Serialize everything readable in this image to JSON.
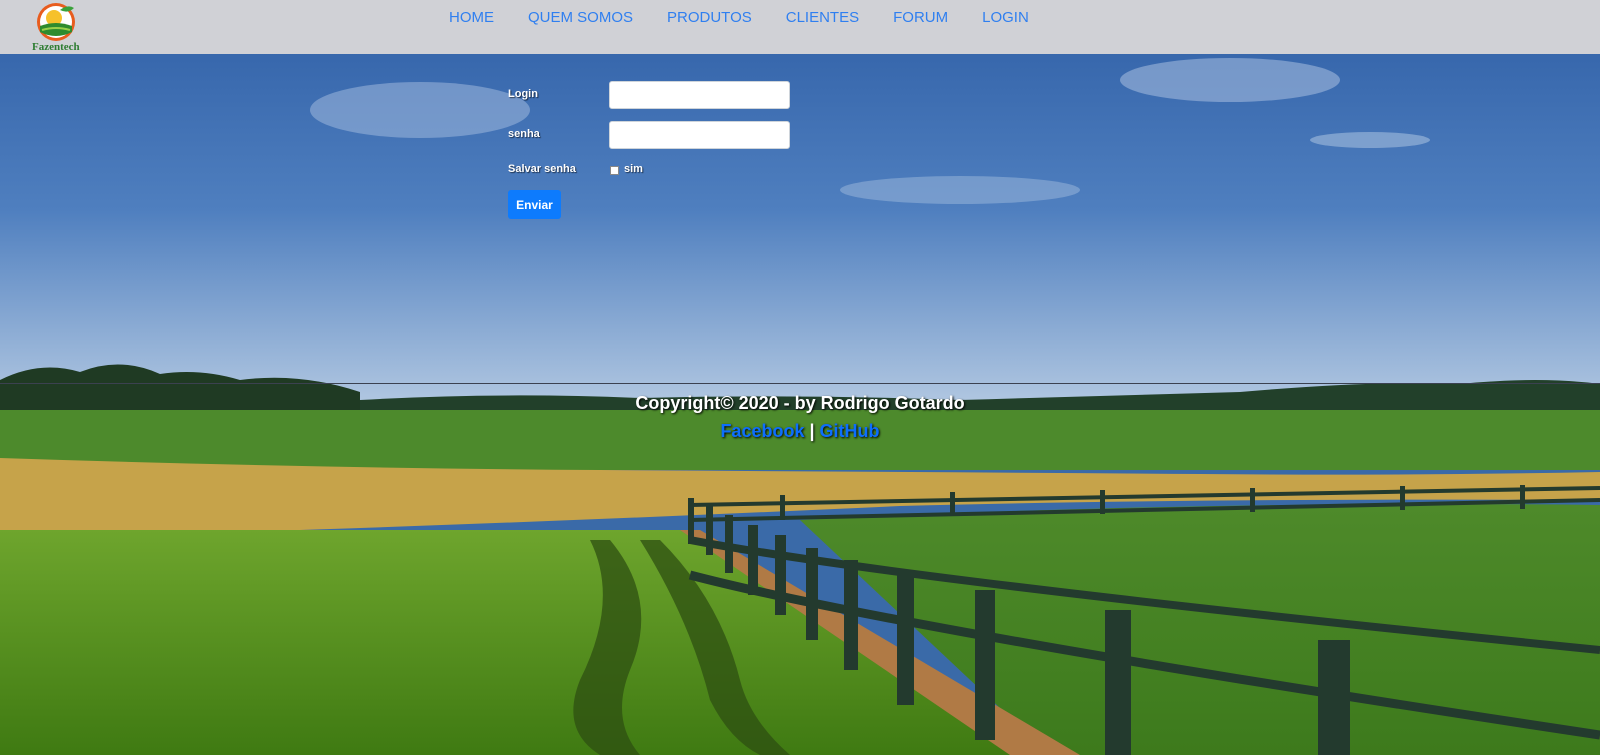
{
  "brand": {
    "name": "Fazentech"
  },
  "nav": {
    "items": [
      {
        "label": "HOME"
      },
      {
        "label": "QUEM SOMOS"
      },
      {
        "label": "PRODUTOS"
      },
      {
        "label": "CLIENTES"
      },
      {
        "label": "FORUM"
      },
      {
        "label": "LOGIN"
      }
    ]
  },
  "form": {
    "login_label": "Login",
    "login_value": "",
    "password_label": "senha",
    "password_value": "",
    "save_label": "Salvar senha",
    "save_option_label": "sim",
    "save_checked": false,
    "submit_label": "Enviar"
  },
  "footer": {
    "copyright": "Copyright© 2020 - by Rodrigo Gotardo",
    "facebook_label": "Facebook",
    "separator": "|",
    "github_label": "GitHub"
  },
  "colors": {
    "navbar_bg": "#d0d1d6",
    "nav_link": "#2f7ff0",
    "button_bg": "#0d7bfd",
    "footer_link": "#0d6efd"
  }
}
